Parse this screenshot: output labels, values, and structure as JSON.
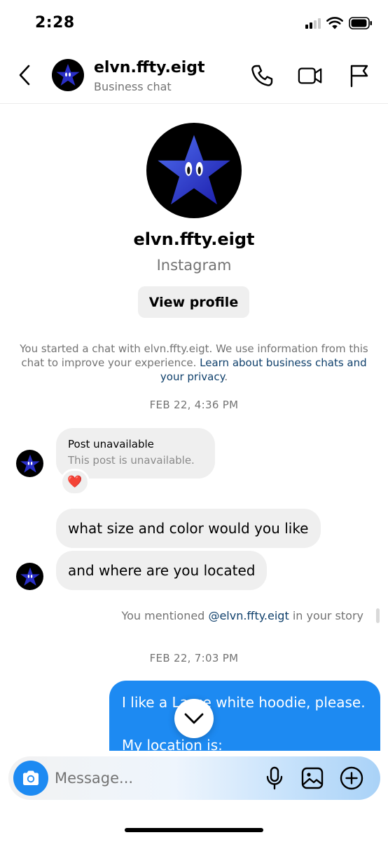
{
  "status_bar": {
    "time": "2:28"
  },
  "header": {
    "name": "elvn.ffty.eigt",
    "subtitle": "Business chat",
    "icons": [
      "back-chevron-icon",
      "phone-icon",
      "video-camera-icon",
      "flag-icon"
    ]
  },
  "profile": {
    "name": "elvn.ffty.eigt",
    "platform": "Instagram",
    "view_profile_label": "View profile"
  },
  "disclaimer": {
    "text": "You started a chat with elvn.ffty.eigt. We use information from this chat to improve your experience.",
    "link": "Learn about business chats and your privacy",
    "end": "."
  },
  "messages": {
    "timestamp_1": "FEB 22, 4:36 PM",
    "post_title": "Post unavailable",
    "post_subtitle": "This post is unavailable.",
    "reaction": "❤️",
    "msg_1": "what size and color would you like",
    "msg_2": "and where are you located",
    "mention_prefix": "You mentioned",
    "mention_handle": "@elvn.ffty.eigt",
    "mention_suffix": "in your story",
    "timestamp_2": "FEB 22, 7:03 PM",
    "outgoing_line_1": "I like a Large white hoodie, please.",
    "outgoing_line_2": "My location is:"
  },
  "composer": {
    "placeholder": "Message...",
    "icons": [
      "camera-icon",
      "microphone-icon",
      "gallery-icon",
      "add-circle-icon"
    ]
  },
  "colors": {
    "accent_blue": "#1d8af2",
    "link_blue": "#0e3f6b",
    "incoming_bubble": "#efefef",
    "secondary_text": "#737373"
  }
}
